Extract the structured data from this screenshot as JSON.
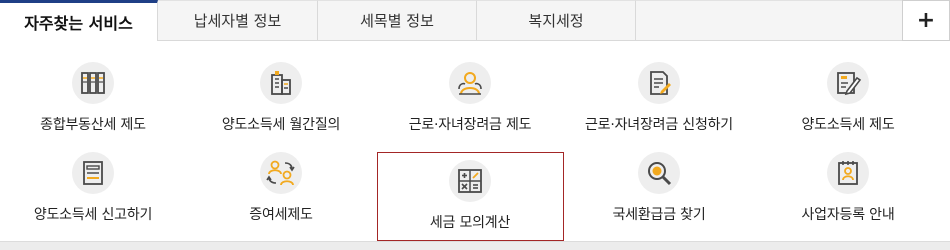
{
  "tabs": [
    {
      "label": "자주찾는 서비스",
      "active": true
    },
    {
      "label": "납세자별 정보",
      "active": false
    },
    {
      "label": "세목별 정보",
      "active": false
    },
    {
      "label": "복지세정",
      "active": false
    }
  ],
  "add_tab_label": "+",
  "services": [
    {
      "label": "종합부동산세 제도",
      "icon": "books-icon"
    },
    {
      "label": "양도소득세 월간질의",
      "icon": "building-icon"
    },
    {
      "label": "근로·자녀장려금 제도",
      "icon": "people-icon"
    },
    {
      "label": "근로·자녀장려금 신청하기",
      "icon": "document-edit-icon"
    },
    {
      "label": "양도소득세 제도",
      "icon": "pencil-note-icon"
    },
    {
      "label": "양도소득세 신고하기",
      "icon": "form-icon"
    },
    {
      "label": "증여세제도",
      "icon": "exchange-people-icon"
    },
    {
      "label": "세금 모의계산",
      "icon": "calculator-icon",
      "selected": true
    },
    {
      "label": "국세환급금 찾기",
      "icon": "magnifier-coin-icon"
    },
    {
      "label": "사업자등록 안내",
      "icon": "id-card-icon"
    }
  ],
  "colors": {
    "accent": "#1f3f86",
    "icon_yellow": "#f2a91e",
    "icon_dark": "#4a4a4a",
    "highlight": "#a32626"
  }
}
